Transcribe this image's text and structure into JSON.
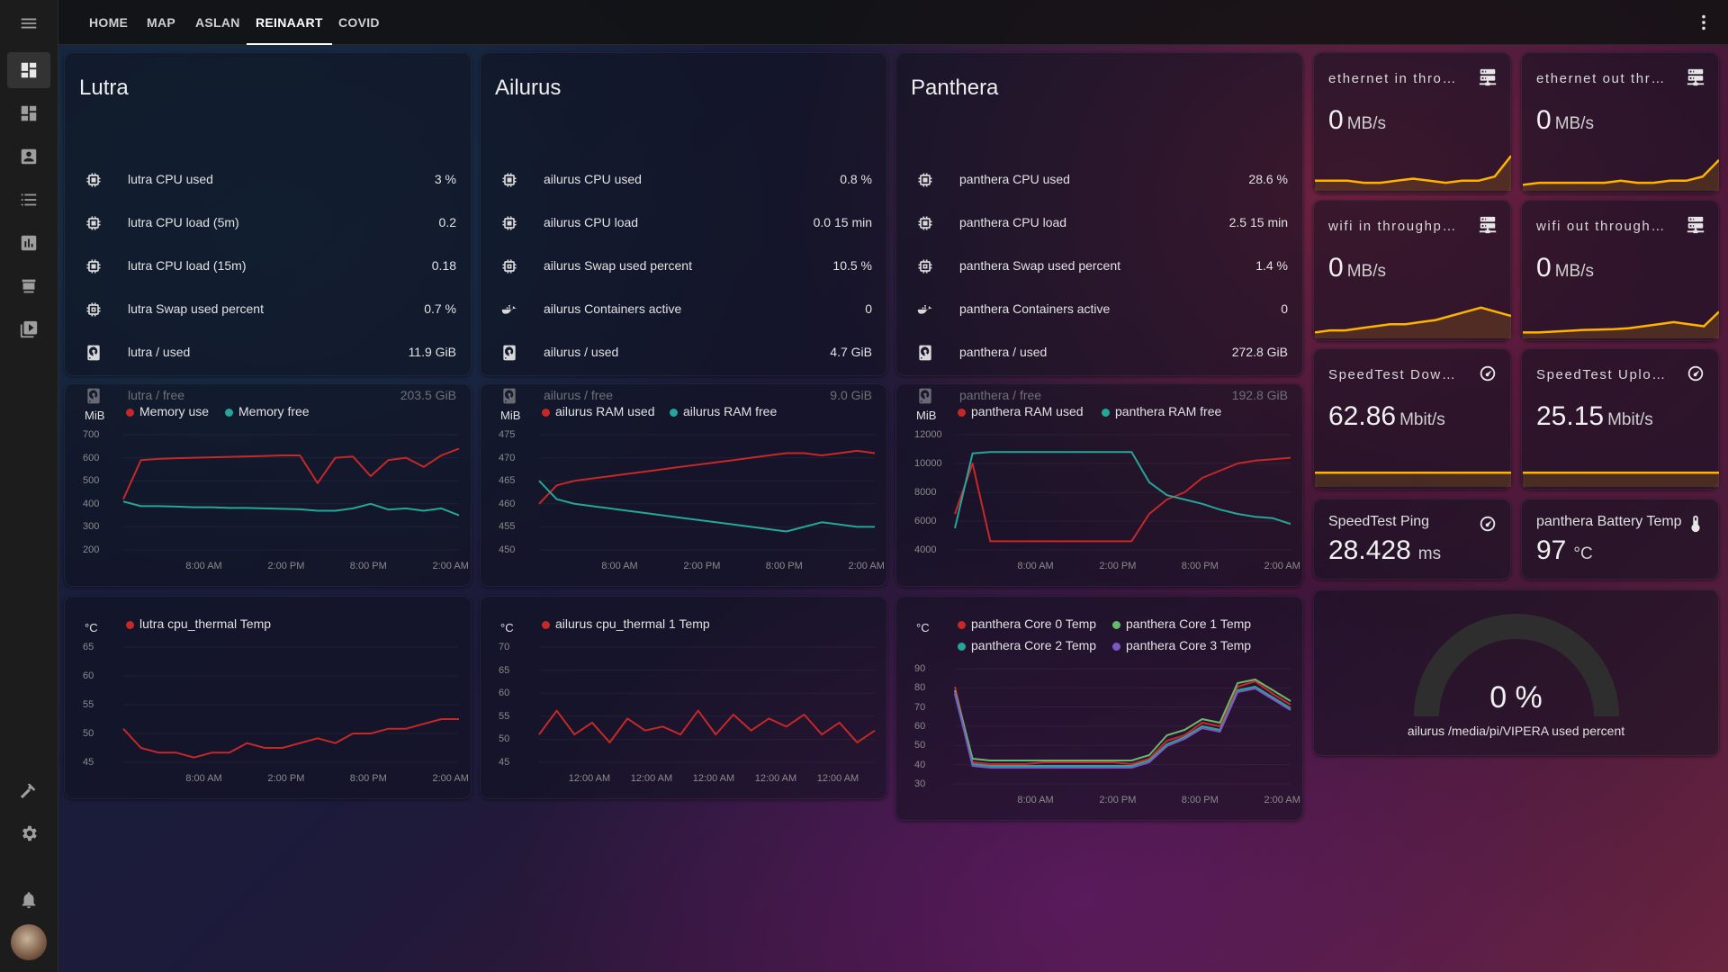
{
  "nav": {
    "tabs": [
      "HOME",
      "MAP",
      "ASLAN",
      "REINAART",
      "COVID"
    ],
    "active": "REINAART"
  },
  "hosts": [
    {
      "title": "Lutra",
      "rows": [
        {
          "icon": "cpu-icon",
          "name": "lutra CPU used",
          "value": "3 %"
        },
        {
          "icon": "cpu-icon",
          "name": "lutra CPU load (5m)",
          "value": "0.2"
        },
        {
          "icon": "cpu-icon",
          "name": "lutra CPU load (15m)",
          "value": "0.18"
        },
        {
          "icon": "memory-icon",
          "name": "lutra Swap used percent",
          "value": "0.7 %"
        },
        {
          "icon": "harddisk-icon",
          "name": "lutra / used",
          "value": "11.9 GiB"
        },
        {
          "icon": "harddisk-icon",
          "name": "lutra / free",
          "value": "203.5 GiB"
        }
      ]
    },
    {
      "title": "Ailurus",
      "rows": [
        {
          "icon": "cpu-icon",
          "name": "ailurus CPU used",
          "value": "0.8 %"
        },
        {
          "icon": "cpu-icon",
          "name": "ailurus CPU load",
          "value": "0.0 15 min"
        },
        {
          "icon": "memory-icon",
          "name": "ailurus Swap used percent",
          "value": "10.5 %"
        },
        {
          "icon": "docker-icon",
          "name": "ailurus Containers active",
          "value": "0"
        },
        {
          "icon": "harddisk-icon",
          "name": "ailurus / used",
          "value": "4.7 GiB"
        },
        {
          "icon": "harddisk-icon",
          "name": "ailurus / free",
          "value": "9.0 GiB"
        }
      ]
    },
    {
      "title": "Panthera",
      "rows": [
        {
          "icon": "cpu-icon",
          "name": "panthera CPU used",
          "value": "28.6 %"
        },
        {
          "icon": "cpu-icon",
          "name": "panthera CPU load",
          "value": "2.5 15 min"
        },
        {
          "icon": "memory-icon",
          "name": "panthera Swap used percent",
          "value": "1.4 %"
        },
        {
          "icon": "docker-icon",
          "name": "panthera Containers active",
          "value": "0"
        },
        {
          "icon": "harddisk-icon",
          "name": "panthera / used",
          "value": "272.8 GiB"
        },
        {
          "icon": "harddisk-icon",
          "name": "panthera / free",
          "value": "192.8 GiB"
        }
      ]
    }
  ],
  "colors": {
    "red": "#c62828",
    "teal": "#26a69a",
    "green": "#66bb6a",
    "purple": "#7e57c2",
    "orange": "#ffb300"
  },
  "chart_data": [
    {
      "type": "line",
      "unit": "MiB",
      "legend": [
        "Memory use",
        "Memory free"
      ],
      "yticks": [
        "700",
        "600",
        "500",
        "400",
        "300",
        "200"
      ],
      "xticks": [
        "8:00 AM",
        "2:00 PM",
        "8:00 PM",
        "2:00 AM"
      ],
      "ylim": [
        200,
        700
      ],
      "series": [
        {
          "name": "Memory use",
          "color": "#c62828",
          "values": [
            420,
            590,
            595,
            598,
            600,
            602,
            604,
            606,
            608,
            610,
            610,
            490,
            600,
            605,
            520,
            590,
            600,
            560,
            610,
            640
          ]
        },
        {
          "name": "Memory free",
          "color": "#26a69a",
          "values": [
            410,
            390,
            390,
            388,
            385,
            385,
            382,
            382,
            380,
            378,
            376,
            370,
            370,
            380,
            400,
            375,
            380,
            370,
            380,
            350
          ]
        }
      ]
    },
    {
      "type": "line",
      "unit": "MiB",
      "legend": [
        "ailurus RAM used",
        "ailurus RAM free"
      ],
      "yticks": [
        "475",
        "470",
        "465",
        "460",
        "455",
        "450"
      ],
      "xticks": [
        "8:00 AM",
        "2:00 PM",
        "8:00 PM",
        "2:00 AM"
      ],
      "ylim": [
        450,
        475
      ],
      "series": [
        {
          "name": "ailurus RAM used",
          "color": "#c62828",
          "values": [
            460,
            464,
            465,
            465.5,
            466,
            466.5,
            467,
            467.5,
            468,
            468.5,
            469,
            469.5,
            470,
            470.5,
            471,
            471,
            470.5,
            471,
            471.5,
            471
          ]
        },
        {
          "name": "ailurus RAM free",
          "color": "#26a69a",
          "values": [
            465,
            461,
            460,
            459.5,
            459,
            458.5,
            458,
            457.5,
            457,
            456.5,
            456,
            455.5,
            455,
            454.5,
            454,
            455,
            456,
            455.5,
            455,
            455
          ]
        }
      ]
    },
    {
      "type": "line",
      "unit": "MiB",
      "legend": [
        "panthera RAM used",
        "panthera RAM free"
      ],
      "yticks": [
        "12000",
        "10000",
        "8000",
        "6000",
        "4000"
      ],
      "xticks": [
        "8:00 AM",
        "2:00 PM",
        "8:00 PM",
        "2:00 AM"
      ],
      "ylim": [
        4000,
        12000
      ],
      "series": [
        {
          "name": "panthera RAM used",
          "color": "#c62828",
          "values": [
            6500,
            10000,
            4600,
            4600,
            4600,
            4600,
            4600,
            4600,
            4600,
            4600,
            4600,
            6500,
            7500,
            8000,
            9000,
            9500,
            10000,
            10200,
            10300,
            10400
          ]
        },
        {
          "name": "panthera RAM free",
          "color": "#26a69a",
          "values": [
            5500,
            10700,
            10800,
            10800,
            10800,
            10800,
            10800,
            10800,
            10800,
            10800,
            10800,
            8700,
            7800,
            7500,
            7200,
            6800,
            6500,
            6300,
            6200,
            5800
          ]
        }
      ]
    },
    {
      "type": "line",
      "unit": "°C",
      "legend": [
        "lutra cpu_thermal Temp"
      ],
      "yticks": [
        "65",
        "60",
        "55",
        "50",
        "45"
      ],
      "xticks": [
        "8:00 AM",
        "2:00 PM",
        "8:00 PM",
        "2:00 AM"
      ],
      "ylim": [
        43,
        67
      ],
      "series": [
        {
          "name": "lutra cpu_thermal Temp",
          "color": "#c62828",
          "values": [
            50,
            46,
            45,
            45,
            44,
            45,
            45,
            47,
            46,
            46,
            47,
            48,
            47,
            49,
            49,
            50,
            50,
            51,
            52,
            52
          ]
        }
      ]
    },
    {
      "type": "line",
      "unit": "°C",
      "legend": [
        "ailurus cpu_thermal 1 Temp"
      ],
      "yticks": [
        "70",
        "65",
        "60",
        "55",
        "50",
        "45"
      ],
      "xticks": [
        "12:00 AM",
        "12:00 AM",
        "12:00 AM",
        "12:00 AM",
        "12:00 AM"
      ],
      "ylim": [
        43,
        72
      ],
      "series": [
        {
          "name": "ailurus cpu_thermal 1 Temp",
          "color": "#c62828",
          "values": [
            50,
            56,
            50,
            53,
            48,
            54,
            51,
            52,
            50,
            56,
            50,
            55,
            51,
            54,
            52,
            55,
            50,
            53,
            48,
            51
          ]
        }
      ]
    },
    {
      "type": "line",
      "unit": "°C",
      "legend": [
        "panthera Core 0 Temp",
        "panthera Core 1 Temp",
        "panthera Core 2 Temp",
        "panthera Core 3 Temp"
      ],
      "yticks": [
        "90",
        "80",
        "70",
        "60",
        "50",
        "40",
        "30"
      ],
      "xticks": [
        "8:00 AM",
        "2:00 PM",
        "8:00 PM",
        "2:00 AM"
      ],
      "ylim": [
        28,
        92
      ],
      "series": [
        {
          "name": "panthera Core 0 Temp",
          "color": "#c62828",
          "values": [
            82,
            40,
            39,
            39,
            39,
            40,
            40,
            40,
            40,
            40,
            39,
            42,
            52,
            55,
            62,
            60,
            82,
            85,
            78,
            72
          ]
        },
        {
          "name": "panthera Core 1 Temp",
          "color": "#66bb6a",
          "values": [
            80,
            42,
            41,
            41,
            41,
            41,
            41,
            41,
            41,
            41,
            41,
            44,
            55,
            58,
            64,
            62,
            84,
            86,
            80,
            74
          ]
        },
        {
          "name": "panthera Core 2 Temp",
          "color": "#26a69a",
          "values": [
            78,
            39,
            38,
            38,
            38,
            38,
            38,
            38,
            38,
            38,
            38,
            41,
            50,
            54,
            60,
            58,
            80,
            82,
            76,
            70
          ]
        },
        {
          "name": "panthera Core 3 Temp",
          "color": "#7e57c2",
          "values": [
            79,
            38,
            37,
            37,
            37,
            37,
            37,
            37,
            37,
            37,
            37,
            40,
            49,
            53,
            59,
            57,
            79,
            81,
            75,
            69
          ]
        }
      ]
    }
  ],
  "stats": [
    {
      "label": "ethernet in thro…",
      "value": "0",
      "unit": "MB/s",
      "icon": "server-network-icon",
      "spark": [
        2,
        2,
        2,
        1.5,
        1.5,
        2,
        2.5,
        2,
        1.5,
        2,
        2,
        3,
        8
      ]
    },
    {
      "label": "ethernet out thr…",
      "value": "0",
      "unit": "MB/s",
      "icon": "server-network-icon",
      "spark": [
        1,
        1.5,
        1.5,
        1.5,
        1.5,
        1.5,
        2,
        1.5,
        1.5,
        2,
        2,
        3,
        7
      ]
    },
    {
      "label": "wifi in throughp…",
      "value": "0",
      "unit": "MB/s",
      "icon": "server-network-icon",
      "spark": [
        1,
        1.5,
        1.5,
        2,
        2.5,
        3,
        3,
        3.5,
        4,
        5,
        6,
        7,
        6,
        5
      ]
    },
    {
      "label": "wifi out through…",
      "value": "0",
      "unit": "MB/s",
      "icon": "server-network-icon",
      "spark": [
        1,
        1,
        1.2,
        1.4,
        1.6,
        1.7,
        1.8,
        2,
        2.5,
        3,
        3.5,
        3,
        2.5,
        6
      ]
    },
    {
      "label": "SpeedTest Dow…",
      "value": "62.86",
      "unit": "Mbit/s",
      "icon": "speedometer-icon",
      "spark": [
        3,
        3,
        3,
        3,
        3,
        3,
        3,
        3,
        3,
        3,
        3,
        3,
        3,
        3
      ]
    },
    {
      "label": "SpeedTest Uplo…",
      "value": "25.15",
      "unit": "Mbit/s",
      "icon": "speedometer-icon",
      "spark": [
        3,
        3,
        3,
        3,
        3,
        3,
        3,
        3,
        3,
        3,
        3,
        3,
        3,
        3
      ]
    }
  ],
  "ping": {
    "label": "SpeedTest Ping",
    "value": "28.428",
    "unit": "ms"
  },
  "battery": {
    "label": "panthera Battery Temp",
    "value": "97",
    "unit": "°C"
  },
  "gauge": {
    "value": "0 %",
    "label": "ailurus /media/pi/VIPERA used percent",
    "fraction": 0
  }
}
